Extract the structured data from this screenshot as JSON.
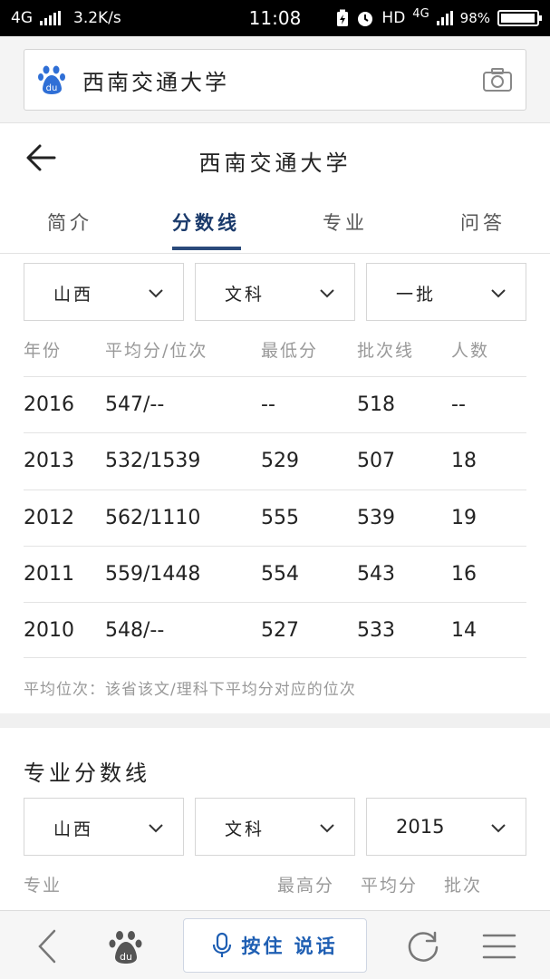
{
  "status_bar": {
    "network": "4G",
    "speed": "3.2K/s",
    "time": "11:08",
    "hd": "HD",
    "network_right": "4G",
    "battery": "98%",
    "battery_level": 0.98
  },
  "search": {
    "query": "西南交通大学"
  },
  "header": {
    "title": "西南交通大学"
  },
  "tabs": [
    {
      "label": "简介",
      "active": false
    },
    {
      "label": "分数线",
      "active": true
    },
    {
      "label": "专业",
      "active": false
    },
    {
      "label": "问答",
      "active": false
    }
  ],
  "filters": {
    "province": "山西",
    "subject": "文科",
    "batch": "一批"
  },
  "score_table": {
    "headers": [
      "年份",
      "平均分/位次",
      "最低分",
      "批次线",
      "人数"
    ],
    "rows": [
      [
        "2016",
        "547/--",
        "--",
        "518",
        "--"
      ],
      [
        "2013",
        "532/1539",
        "529",
        "507",
        "18"
      ],
      [
        "2012",
        "562/1110",
        "555",
        "539",
        "19"
      ],
      [
        "2011",
        "559/1448",
        "554",
        "543",
        "16"
      ],
      [
        "2010",
        "548/--",
        "527",
        "533",
        "14"
      ]
    ],
    "note": "平均位次：该省该文/理科下平均分对应的位次"
  },
  "major_section": {
    "title": "专业分数线",
    "filters": {
      "province": "山西",
      "subject": "文科",
      "year": "2015"
    },
    "headers": [
      "专业",
      "最高分",
      "平均分",
      "批次"
    ]
  },
  "bottom_nav": {
    "voice_label": "按住 说话"
  },
  "colors": {
    "accent": "#2a4a7b",
    "voice": "#1f5fb3",
    "baidu_blue": "#2f6fd6"
  }
}
